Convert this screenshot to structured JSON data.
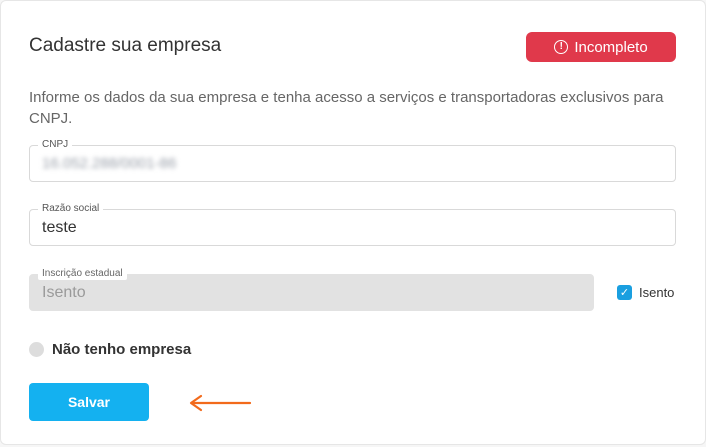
{
  "header": {
    "title": "Cadastre sua empresa",
    "status_badge": {
      "label": "Incompleto",
      "icon": "alert-circle-icon",
      "color": "#e0394b"
    }
  },
  "description": "Informe os dados da sua empresa e tenha acesso a serviços e transportadoras exclusivos para CNPJ.",
  "form": {
    "cnpj": {
      "label": "CNPJ",
      "value": "16.052.288/0001-86"
    },
    "razao_social": {
      "label": "Razão social",
      "value": "teste"
    },
    "inscricao_estadual": {
      "label": "Inscrição estadual",
      "value": "Isento",
      "disabled": true
    },
    "isento_checkbox": {
      "label": "Isento",
      "checked": true
    },
    "no_company_radio": {
      "label": "Não tenho empresa",
      "selected": false
    },
    "save_button": {
      "label": "Salvar",
      "color": "#14b1f0"
    }
  },
  "annotation": {
    "icon": "left-arrow-icon",
    "color": "#f26a1b"
  }
}
